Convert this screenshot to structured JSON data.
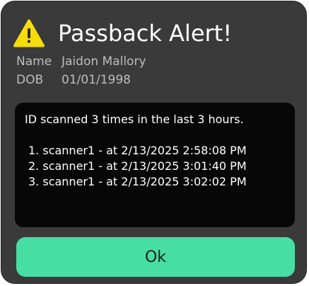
{
  "dialog": {
    "title": "Passback Alert!",
    "icon": "warning-triangle-icon",
    "colors": {
      "background": "#3a3a3a",
      "icon_fill": "#f5dd0b",
      "message_background": "#070707",
      "button": "#47dea5"
    }
  },
  "person": {
    "name_label": "Name",
    "name_value": "Jaidon Mallory",
    "dob_label": "DOB",
    "dob_value": "01/01/1998"
  },
  "message": {
    "summary": "ID scanned 3 times in the last 3 hours.",
    "scans": [
      "1. scanner1 - at 2/13/2025 2:58:08 PM",
      "2. scanner1 - at 2/13/2025 3:01:40 PM",
      "3. scanner1 - at 2/13/2025 3:02:02 PM"
    ]
  },
  "actions": {
    "ok_label": "Ok"
  }
}
